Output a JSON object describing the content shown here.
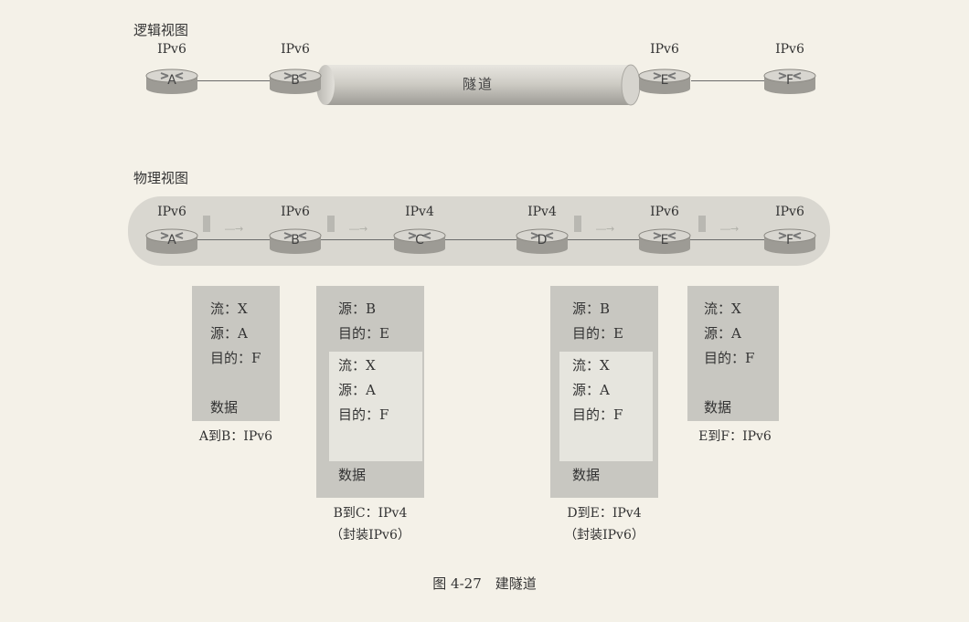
{
  "logical": {
    "title": "逻辑视图",
    "tunnel_label": "隧道",
    "routers": [
      {
        "id": "A",
        "proto": "IPv6"
      },
      {
        "id": "B",
        "proto": "IPv6"
      },
      {
        "id": "E",
        "proto": "IPv6"
      },
      {
        "id": "F",
        "proto": "IPv6"
      }
    ]
  },
  "physical": {
    "title": "物理视图",
    "routers": [
      {
        "id": "A",
        "proto": "IPv6"
      },
      {
        "id": "B",
        "proto": "IPv6"
      },
      {
        "id": "C",
        "proto": "IPv4"
      },
      {
        "id": "D",
        "proto": "IPv4"
      },
      {
        "id": "E",
        "proto": "IPv6"
      },
      {
        "id": "F",
        "proto": "IPv6"
      }
    ]
  },
  "packets": {
    "ab": {
      "flow": "流：X",
      "src": "源：A",
      "dst": "目的：F",
      "data": "数据",
      "caption": "A到B：IPv6"
    },
    "bc": {
      "outer_src": "源：B",
      "outer_dst": "目的：E",
      "flow": "流：X",
      "src": "源：A",
      "dst": "目的：F",
      "data": "数据",
      "caption_line1": "B到C：IPv4",
      "caption_line2": "（封装IPv6）"
    },
    "de": {
      "outer_src": "源：B",
      "outer_dst": "目的：E",
      "flow": "流：X",
      "src": "源：A",
      "dst": "目的：F",
      "data": "数据",
      "caption_line1": "D到E：IPv4",
      "caption_line2": "（封装IPv6）"
    },
    "ef": {
      "flow": "流：X",
      "src": "源：A",
      "dst": "目的：F",
      "data": "数据",
      "caption": "E到F：IPv6"
    }
  },
  "figure_caption": "图 4-27　建隧道"
}
